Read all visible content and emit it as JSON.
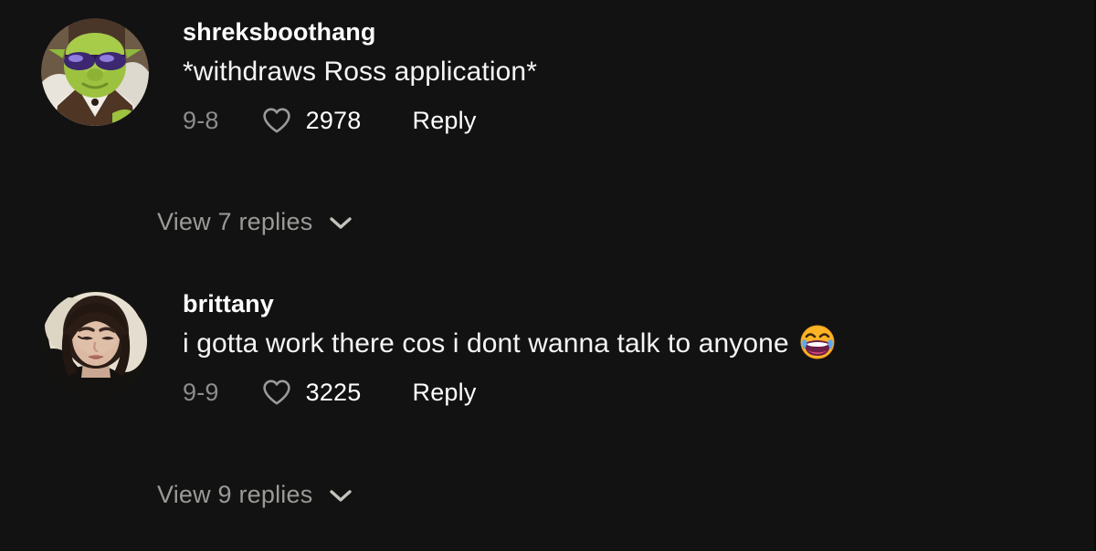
{
  "theme": {
    "background": "#121212",
    "primary_text": "#ffffff",
    "muted_text": "#8c8c8c",
    "replies_text": "#9a9a96"
  },
  "comments": [
    {
      "username": "shreksboothang",
      "text": "*withdraws Ross application*",
      "emoji": "",
      "date": "9-8",
      "like_count": "2978",
      "reply_label": "Reply",
      "view_replies_label": "View 7 replies",
      "heart_icon": "heart-outline-icon",
      "chevron_icon": "chevron-down-icon",
      "avatar_alt": "shrek-avatar"
    },
    {
      "username": "brittany",
      "text": "i gotta work there cos i dont wanna talk to anyone",
      "emoji": "😂",
      "date": "9-9",
      "like_count": "3225",
      "reply_label": "Reply",
      "view_replies_label": "View 9 replies",
      "heart_icon": "heart-outline-icon",
      "chevron_icon": "chevron-down-icon",
      "avatar_alt": "brittany-avatar"
    }
  ]
}
